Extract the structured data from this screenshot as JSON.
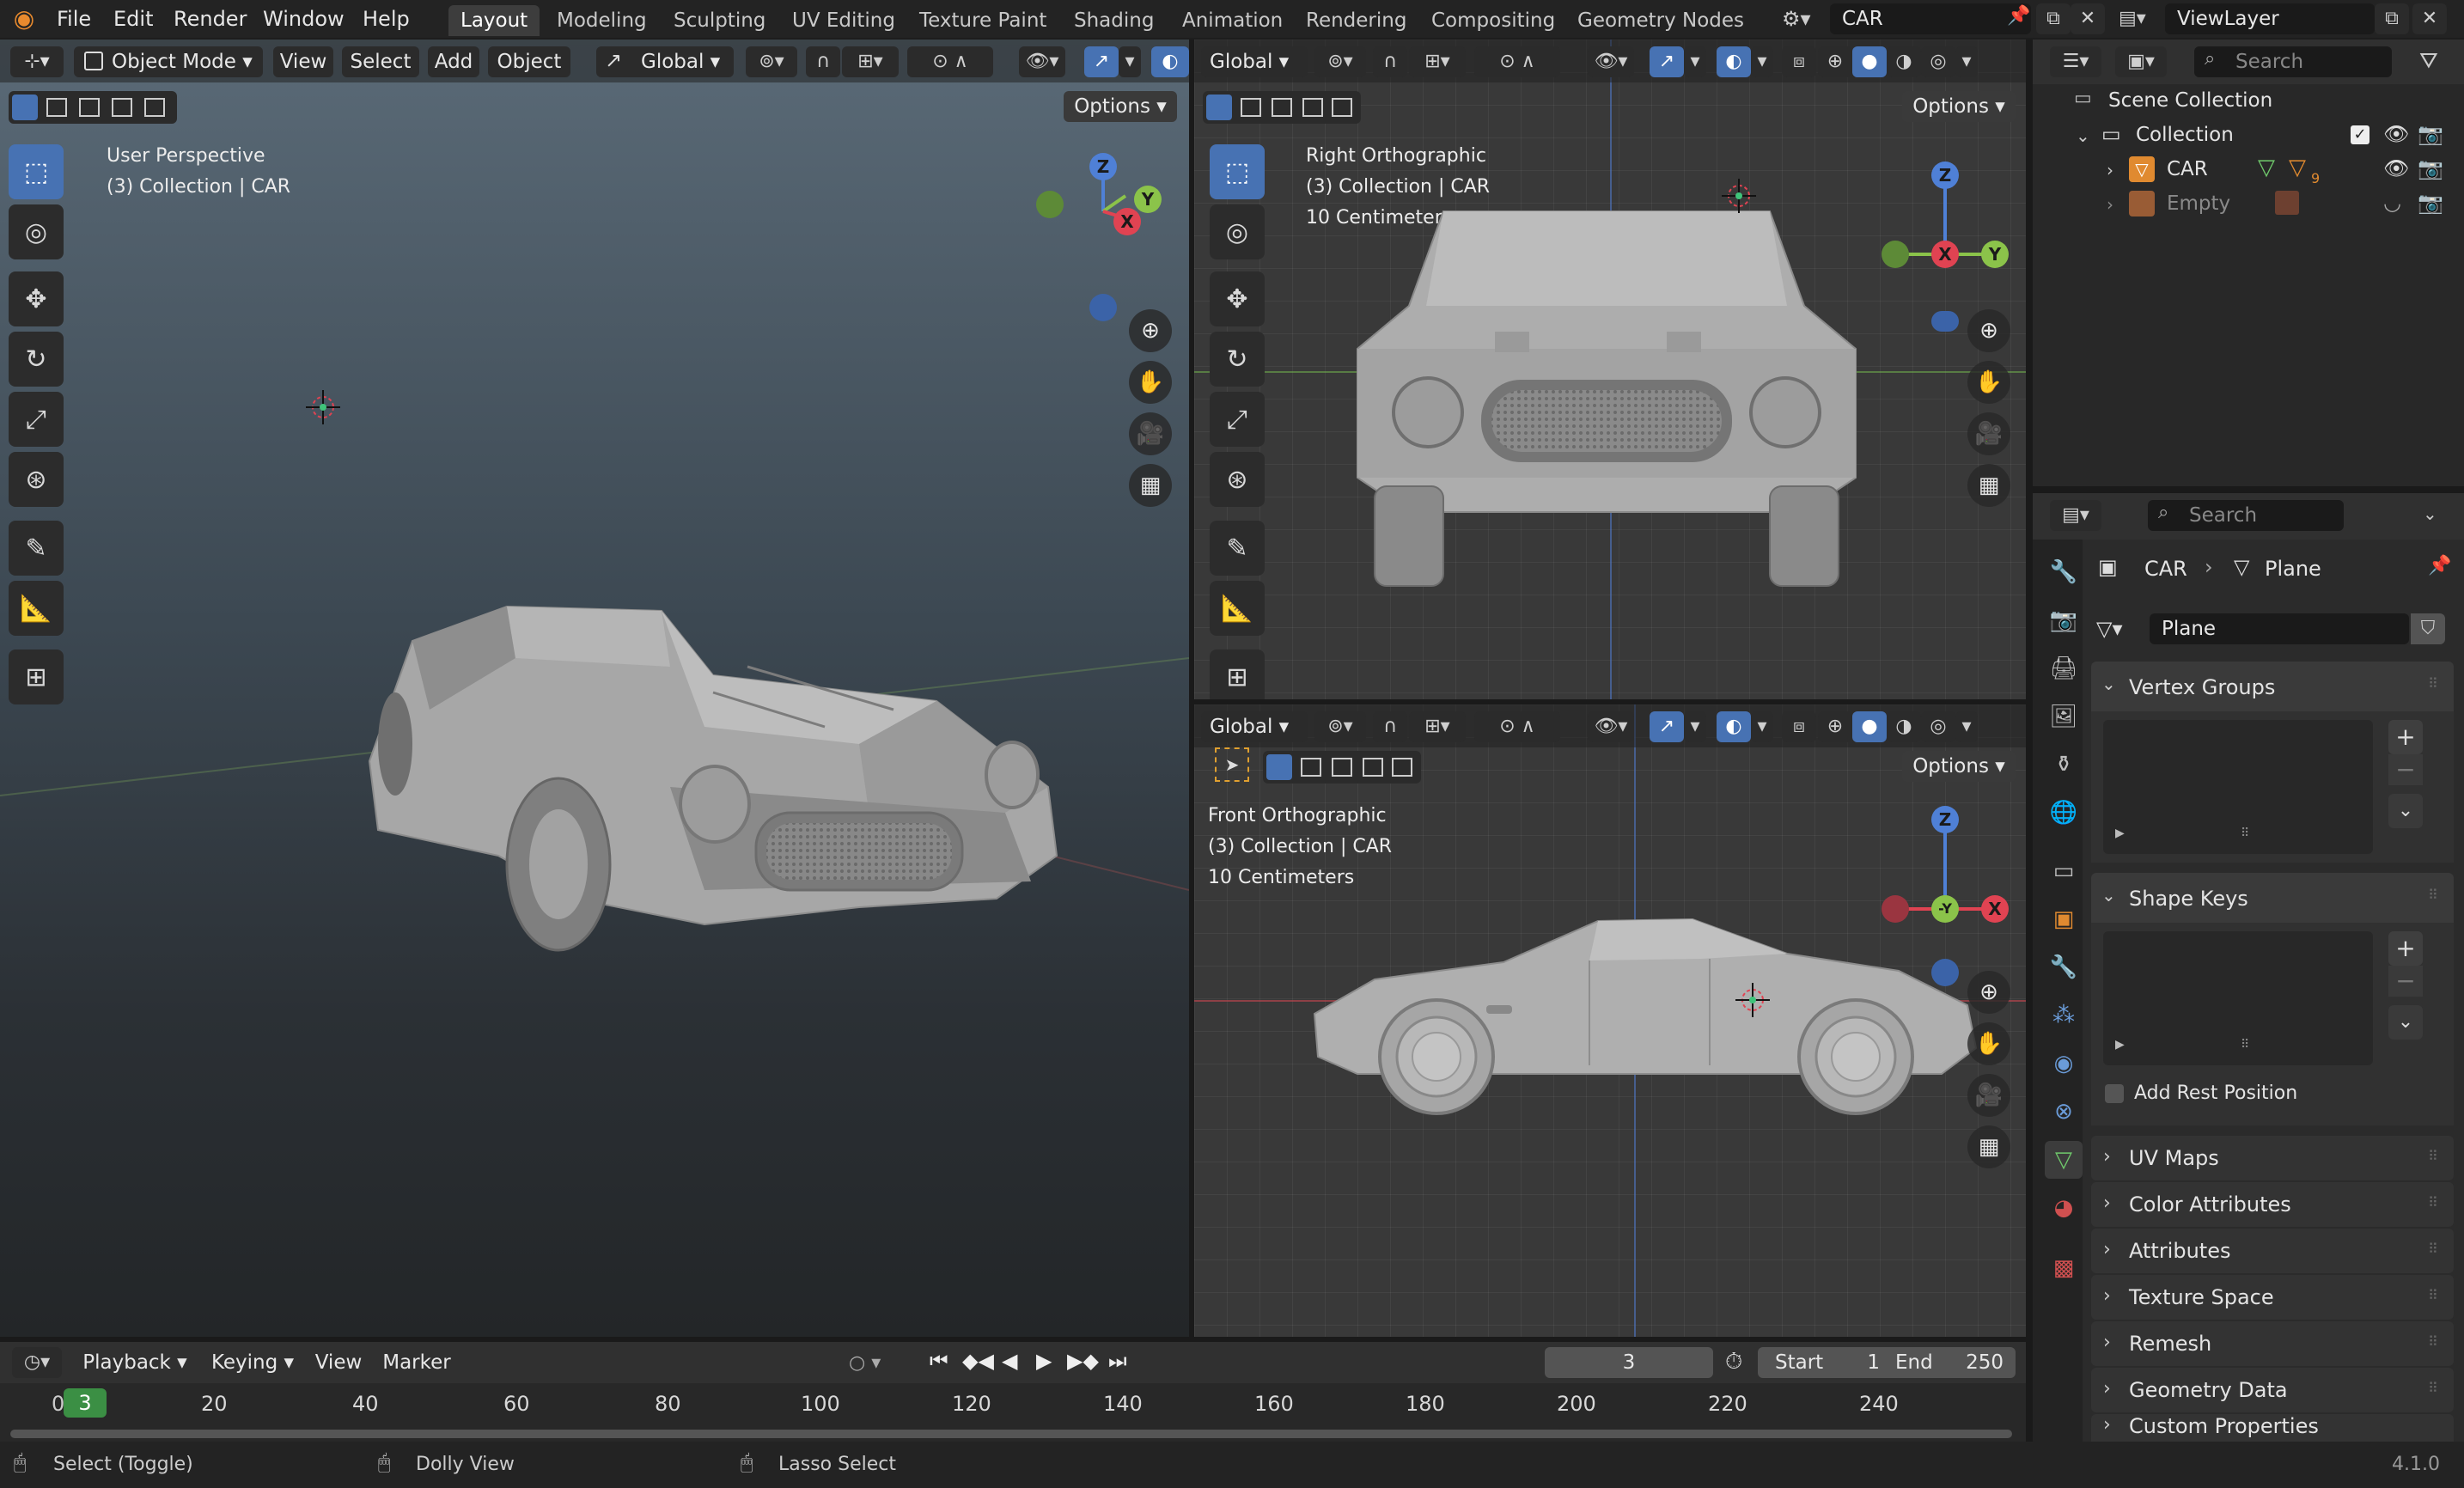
{
  "topbar": {
    "menus": [
      "File",
      "Edit",
      "Render",
      "Window",
      "Help"
    ],
    "workspaces": [
      "Layout",
      "Modeling",
      "Sculpting",
      "UV Editing",
      "Texture Paint",
      "Shading",
      "Animation",
      "Rendering",
      "Compositing",
      "Geometry Nodes"
    ],
    "active_workspace": "Layout",
    "scene": "CAR",
    "view_layer": "ViewLayer"
  },
  "viewport_main": {
    "mode": "Object Mode",
    "menus": [
      "View",
      "Select",
      "Add",
      "Object"
    ],
    "orientation": "Global",
    "options": "Options",
    "view_name": "User Perspective",
    "collection": "(3) Collection | CAR"
  },
  "viewport_right": {
    "orientation": "Global",
    "options": "Options",
    "view_name": "Right Orthographic",
    "collection": "(3) Collection | CAR",
    "scale": "10 Centimeters"
  },
  "viewport_front": {
    "orientation": "Global",
    "options": "Options",
    "view_name": "Front Orthographic",
    "collection": "(3) Collection | CAR",
    "scale": "10 Centimeters"
  },
  "axes": {
    "x": "X",
    "y": "Y",
    "z": "Z",
    "neg_y": "-Y"
  },
  "outliner": {
    "search_placeholder": "Search",
    "root": "Scene Collection",
    "collection": "Collection",
    "items": [
      {
        "name": "CAR",
        "badge": "9"
      },
      {
        "name": "Empty"
      }
    ]
  },
  "properties": {
    "search_placeholder": "Search",
    "breadcrumb_object": "CAR",
    "breadcrumb_data": "Plane",
    "mesh_name": "Plane",
    "sections": {
      "vertex_groups": "Vertex Groups",
      "shape_keys": "Shape Keys",
      "add_rest_position": "Add Rest Position",
      "uv_maps": "UV Maps",
      "color_attributes": "Color Attributes",
      "attributes": "Attributes",
      "texture_space": "Texture Space",
      "remesh": "Remesh",
      "geometry_data": "Geometry Data",
      "custom_properties": "Custom Properties"
    }
  },
  "timeline": {
    "menus": [
      "Playback",
      "Keying",
      "View",
      "Marker"
    ],
    "current_frame": "3",
    "start_label": "Start",
    "start": "1",
    "end_label": "End",
    "end": "250",
    "ruler": [
      "20",
      "40",
      "60",
      "80",
      "100",
      "120",
      "140",
      "160",
      "180",
      "200",
      "220",
      "240"
    ],
    "playhead": "3",
    "ruler_zero": "0"
  },
  "statusbar": {
    "select": "Select (Toggle)",
    "dolly": "Dolly View",
    "lasso": "Lasso Select",
    "version": "4.1.0"
  }
}
